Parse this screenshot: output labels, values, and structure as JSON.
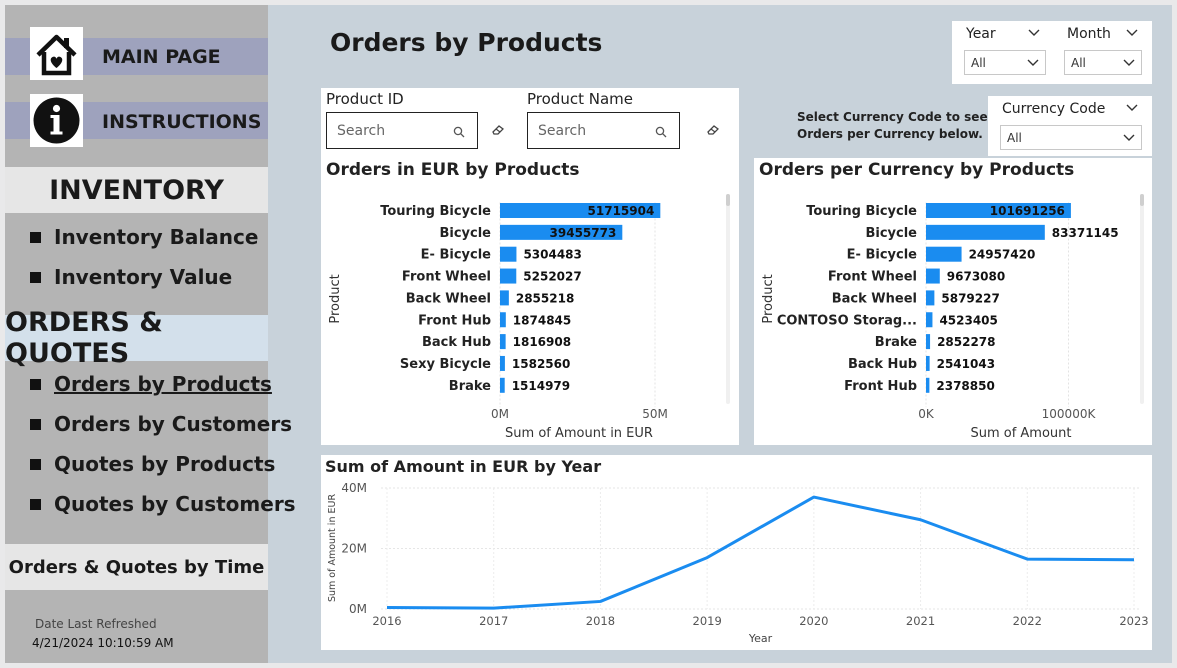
{
  "sidebar": {
    "main_page": "MAIN PAGE",
    "instructions": "INSTRUCTIONS",
    "inventory_header": "INVENTORY",
    "inventory_items": [
      "Inventory Balance",
      "Inventory Value"
    ],
    "orders_header": "ORDERS & QUOTES",
    "orders_items": [
      "Orders by Products",
      "Orders by Customers",
      "Quotes by Products",
      "Quotes by Customers"
    ],
    "time_button": "Orders & Quotes by Time",
    "refresh_label": "Date Last Refreshed",
    "refresh_value": "4/21/2024 10:10:59 AM"
  },
  "page": {
    "title": "Orders by Products"
  },
  "filters": {
    "year": {
      "title": "Year",
      "value": "All"
    },
    "month": {
      "title": "Month",
      "value": "All"
    },
    "currency": {
      "title": "Currency Code",
      "value": "All"
    },
    "currency_note": [
      "Select Currency Code to see",
      "Orders per Currency below."
    ]
  },
  "search": {
    "product_id": {
      "label": "Product ID",
      "placeholder": "Search"
    },
    "product_name": {
      "label": "Product Name",
      "placeholder": "Search"
    }
  },
  "colors": {
    "bar": "#1a8cf0",
    "line": "#1a8cf0",
    "accent_nav": "#9ea2bd"
  },
  "chart_data": [
    {
      "type": "bar",
      "orientation": "horizontal",
      "title": "Orders in EUR by Products",
      "xlabel": "Sum of Amount in EUR",
      "ylabel": "Product",
      "xlim": [
        0,
        70000000
      ],
      "xticks": [
        "0M",
        "50M"
      ],
      "xtick_values": [
        0,
        50000000
      ],
      "categories": [
        "Touring Bicycle",
        "Bicycle",
        "E- Bicycle",
        "Front Wheel",
        "Back Wheel",
        "Front Hub",
        "Back Hub",
        "Sexy Bicycle",
        "Brake"
      ],
      "values": [
        51715904,
        39455773,
        5304483,
        5252027,
        2855218,
        1874845,
        1816908,
        1582560,
        1514979
      ],
      "labels": [
        "51715904",
        "39455773",
        "5304483",
        "5252027",
        "2855218",
        "1874845",
        "1816908",
        "1582560",
        "1514979"
      ],
      "grid": true
    },
    {
      "type": "bar",
      "orientation": "horizontal",
      "title": "Orders per Currency by Products",
      "xlabel": "Sum of Amount",
      "ylabel": "Product",
      "xlim": [
        0,
        160000000
      ],
      "xticks": [
        "0K",
        "100000K"
      ],
      "xtick_values": [
        0,
        100000000
      ],
      "categories": [
        "Touring Bicycle",
        "Bicycle",
        "E- Bicycle",
        "Front Wheel",
        "Back Wheel",
        "CONTOSO Storag...",
        "Brake",
        "Back Hub",
        "Front Hub"
      ],
      "values": [
        101691256,
        83371145,
        24957420,
        9673080,
        5879227,
        4523405,
        2852278,
        2541043,
        2378850
      ],
      "labels": [
        "101691256",
        "83371145",
        "24957420",
        "9673080",
        "5879227",
        "4523405",
        "2852278",
        "2541043",
        "2378850"
      ],
      "grid": true
    },
    {
      "type": "line",
      "title": "Sum of Amount in EUR by Year",
      "xlabel": "Year",
      "ylabel": "Sum of Amount in EUR",
      "x": [
        "2016",
        "2017",
        "2018",
        "2019",
        "2020",
        "2021",
        "2022",
        "2023"
      ],
      "y": [
        500000,
        300000,
        2500000,
        17000000,
        37000000,
        29500000,
        16500000,
        16300000
      ],
      "ylim": [
        0,
        40000000
      ],
      "yticks": [
        "0M",
        "20M",
        "40M"
      ],
      "ytick_values": [
        0,
        20000000,
        40000000
      ],
      "grid": true
    }
  ]
}
